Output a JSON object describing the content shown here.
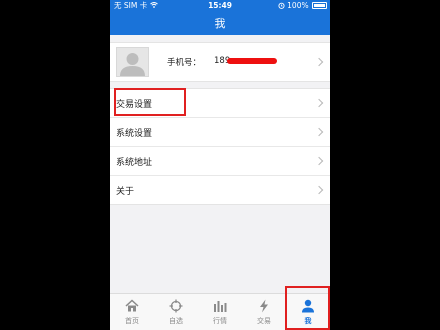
{
  "status_bar": {
    "carrier": "无 SIM 卡",
    "time": "15:49",
    "battery": "100%"
  },
  "nav": {
    "title": "我"
  },
  "profile": {
    "phone_label": "手机号：",
    "phone_visible": "189",
    "redaction_color": "#ee1010"
  },
  "menu": {
    "items": [
      {
        "label": "交易设置"
      },
      {
        "label": "系统设置"
      },
      {
        "label": "系统地址"
      },
      {
        "label": "关于"
      }
    ]
  },
  "tabbar": {
    "tabs": [
      {
        "label": "首页",
        "icon": "home-icon"
      },
      {
        "label": "自选",
        "icon": "crosshair-icon"
      },
      {
        "label": "行情",
        "icon": "bar-chart-icon"
      },
      {
        "label": "交易",
        "icon": "lightning-icon"
      },
      {
        "label": "我",
        "icon": "person-icon",
        "active": true
      }
    ]
  },
  "colors": {
    "primary": "#1a73d9",
    "highlight": "#e02020",
    "tab_inactive": "#8a8a8a"
  }
}
